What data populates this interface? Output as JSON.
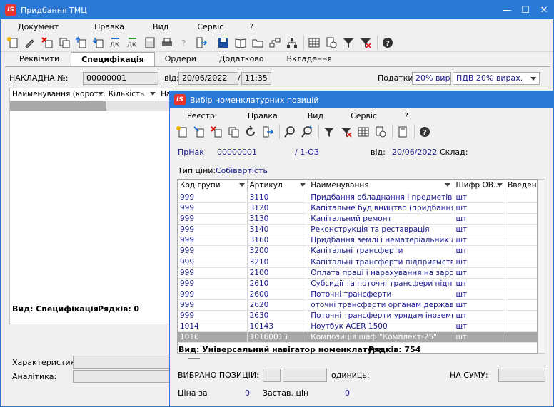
{
  "main": {
    "title": "Придбання ТМЦ",
    "menu": [
      "Документ",
      "Правка",
      "Вид",
      "Сервіс",
      "?"
    ],
    "tabs": [
      "Реквізити",
      "Специфікація",
      "Ордери",
      "Додатково",
      "Вкладення"
    ],
    "nakl_label": "НАКЛАДНА №:",
    "nakl_value": "00000001",
    "vid_label": "від:",
    "date": "20/06/2022",
    "time": "11:35",
    "taxes_label": "Податки:",
    "tax1": "20% вир",
    "tax2": "ПДВ 20%  вирах.",
    "columns": [
      "Найменування (корот...",
      "Кількість",
      "На"
    ],
    "footer_view": "Вид: Специфікація",
    "footer_rows": "Рядків: 0",
    "characteristics_label": "Характеристики:",
    "analytics_label": "Аналітика:"
  },
  "dialog": {
    "title": "Вибір номенклатурних позицій",
    "menu": [
      "Реєстр",
      "Правка",
      "Вид",
      "Сервіс",
      "?"
    ],
    "prnak_label": "ПрНак",
    "prnak_num": "00000001",
    "prnak_suffix": "/ 1-ОЗ",
    "vid_label": "від:",
    "date": "20/06/2022",
    "sklad_label": "Склад:",
    "price_type_label": "Тип ціни:",
    "price_type_value": "Собівартість",
    "columns": [
      "Код групи",
      "Артикул",
      "Найменування",
      "Шифр ОВ...",
      "Введен"
    ],
    "rows": [
      [
        "999",
        "3110",
        "Придбання обладнання і предметів до...",
        "шт"
      ],
      [
        "999",
        "3120",
        "Капітальне будівництво (придбання)",
        "шт"
      ],
      [
        "999",
        "3130",
        "Капітальний ремонт",
        "шт"
      ],
      [
        "999",
        "3140",
        "Реконструкція та реставрація",
        "шт"
      ],
      [
        "999",
        "3160",
        "Придбання землі і нематеріальних ак...",
        "шт"
      ],
      [
        "999",
        "3200",
        "Капітальні трансферти",
        "шт"
      ],
      [
        "999",
        "3210",
        "Капітальні трансферти підприємствам (...",
        "шт"
      ],
      [
        "999",
        "2100",
        "Оплата праці і нарахування на заробіт...",
        "шт"
      ],
      [
        "999",
        "2610",
        "Субсидії та поточні трансфери підпри...",
        "шт"
      ],
      [
        "999",
        "2600",
        "Поточні трансферти",
        "шт"
      ],
      [
        "999",
        "2620",
        "оточні трансферти органам державног...",
        "шт"
      ],
      [
        "999",
        "2630",
        "Поточні трансферти урядам іноземних ...",
        "шт"
      ],
      [
        "1014",
        "10143",
        "Ноутбук ACER 1500",
        "шт"
      ],
      [
        "1016",
        "10160013",
        "Композиція шаф \"Комплект-25\"",
        "шт"
      ]
    ],
    "footer_view": "Вид: Універсальний навігатор номенклатура",
    "footer_rows": "Рядків: 754",
    "selected_label": "ВИБРАНО ПОЗИЦІЙ:",
    "units_label": "одиниць:",
    "sum_label": "НА СУМУ:",
    "price_label": "Ціна за",
    "price_value": "0",
    "zastav_label": "Застав. цін",
    "zastav_value": "0"
  },
  "colors": {
    "titlebar": "#2b79d6",
    "grid_text": "#1a1a8f",
    "selected_row": "#a8a8a8"
  }
}
